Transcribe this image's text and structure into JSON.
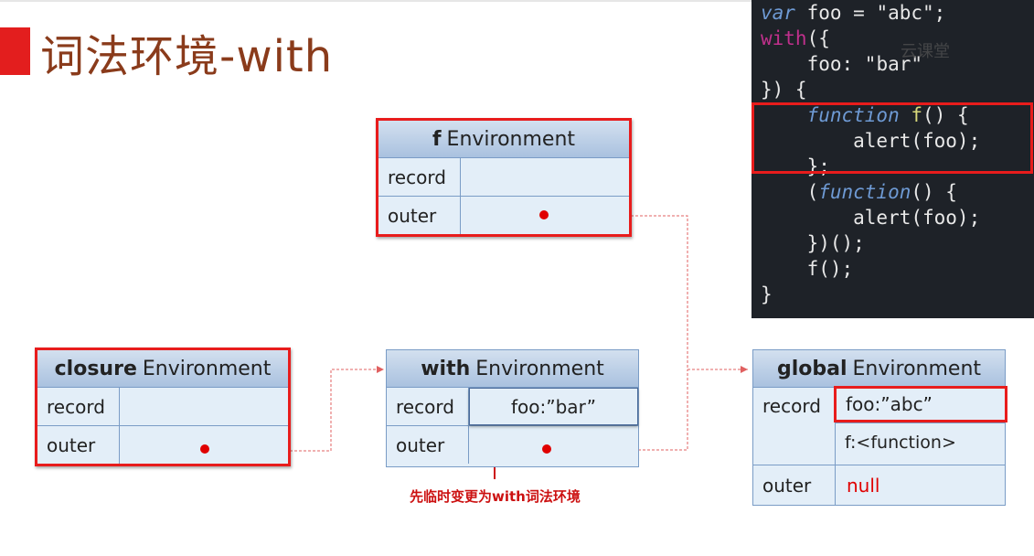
{
  "slide": {
    "title": "词法环境-with",
    "note": "先临时变更为with词法环境"
  },
  "f_env": {
    "name_bold": "f",
    "name_rest": "Environment",
    "rows": [
      {
        "key": "record",
        "value": ""
      },
      {
        "key": "outer",
        "value": ""
      }
    ]
  },
  "closure_env": {
    "name_bold": "closure",
    "name_rest": "Environment",
    "rows": [
      {
        "key": "record",
        "value": ""
      },
      {
        "key": "outer",
        "value": ""
      }
    ]
  },
  "with_env": {
    "name_bold": "with",
    "name_rest": "Environment",
    "rows": [
      {
        "key": "record",
        "value": "foo:”bar”"
      },
      {
        "key": "outer",
        "value": ""
      }
    ]
  },
  "global_env": {
    "name_bold": "global",
    "name_rest": "Environment",
    "record_key": "record",
    "record_values": [
      "foo:”abc”",
      "f:<function>"
    ],
    "outer_key": "outer",
    "outer_value": "null"
  },
  "code": {
    "watermark": "云课堂",
    "lines": [
      [
        "var",
        " foo = ",
        "\"abc\";"
      ],
      [
        "with",
        "({",
        ""
      ],
      [
        "",
        "    foo: ",
        "\"bar\""
      ],
      [
        "",
        "}) {",
        ""
      ],
      [
        "function",
        " f() {",
        ""
      ],
      [
        "",
        "        alert(foo);",
        ""
      ],
      [
        "",
        "    };",
        ""
      ],
      [
        "function",
        "    (",
        "() {"
      ],
      [
        "",
        "        alert(foo);",
        ""
      ],
      [
        "",
        "    })();",
        ""
      ],
      [
        "",
        "    f();",
        ""
      ],
      [
        "",
        "}",
        ""
      ]
    ]
  },
  "colors": {
    "accent": "#e31e1e",
    "title": "#8a3b1b",
    "highlight": "#e81c1c",
    "null": "#e00000"
  }
}
